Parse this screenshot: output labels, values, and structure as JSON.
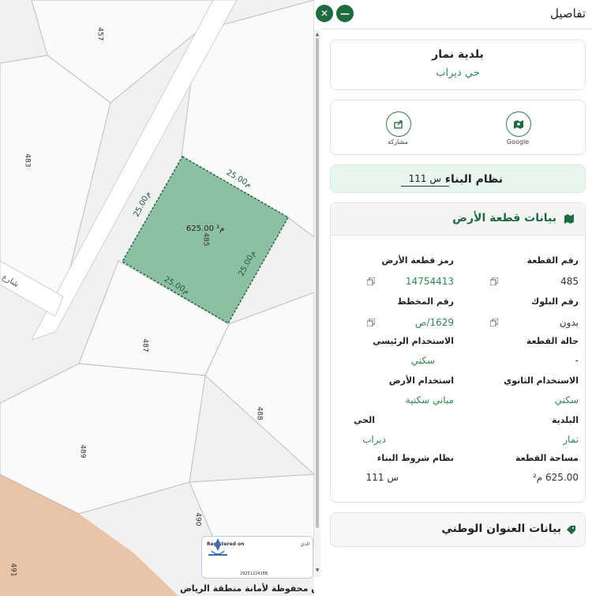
{
  "map": {
    "parcel_numbers": [
      "457",
      "483",
      "485",
      "487",
      "488",
      "489",
      "490",
      "491"
    ],
    "selected_area": "625.00 م²",
    "dimensions": [
      "25.00م",
      "25.00م",
      "25.00م",
      "25.00م"
    ],
    "street_label": "شارع",
    "copyright": "جميع الحقوق محفوظة لأمانة منطقة الرياض",
    "registered_stamp": {
      "title": "Registered on",
      "right_text": "الذي",
      "number": "2925122418B"
    },
    "colors": {
      "parcel_fill": "#8dbfa2",
      "parcel_border": "#1e6b3f",
      "block_fill": "#f9f9f9",
      "road": "#ffffff",
      "terrain": "#e8c4a8"
    }
  },
  "panel": {
    "title": "تفاصيل",
    "minimize_icon": "minus-icon",
    "close_icon": "close-icon",
    "municipality": {
      "name": "بلدية نمار",
      "district": "حي ديراب"
    },
    "actions": [
      {
        "label": "مشاركة",
        "icon": "share-icon"
      },
      {
        "label": "Google",
        "icon": "map-pin-icon"
      }
    ],
    "building_system": {
      "label": "نظام البناء",
      "value": "س 111"
    },
    "land_card": {
      "title": "بيانات قطعة الأرض",
      "icon": "map-icon",
      "fields": [
        {
          "label": "رقم القطعة",
          "value": "485",
          "copy": true
        },
        {
          "label": "رمز قطعة الأرض",
          "value": "14754413",
          "copy": true
        },
        {
          "label": "رقم البلوك",
          "value": "بدون",
          "copy": true
        },
        {
          "label": "رقم المخطط",
          "value": "1629/ص",
          "copy": true
        },
        {
          "label": "حالة القطعة",
          "value": "-",
          "copy": false
        },
        {
          "label": "الاستخدام الرئيسي",
          "value": "سكني",
          "copy": false
        },
        {
          "label": "الاستخدام الثانوي",
          "value": "سكني",
          "copy": false
        },
        {
          "label": "استخدام الأرض",
          "value": "مباني سكنية",
          "copy": false
        },
        {
          "label": "البلدية",
          "value": "نمار",
          "copy": false
        },
        {
          "label": "الحي",
          "value": "ديراب",
          "copy": false
        },
        {
          "label": "مساحة القطعة",
          "value": "625.00 م²",
          "copy": false
        },
        {
          "label": "نظام شروط البناء",
          "value": "س 111",
          "copy": false
        }
      ]
    },
    "address_card": {
      "title": "بيانات العنوان الوطني",
      "icon": "tag-icon"
    }
  }
}
